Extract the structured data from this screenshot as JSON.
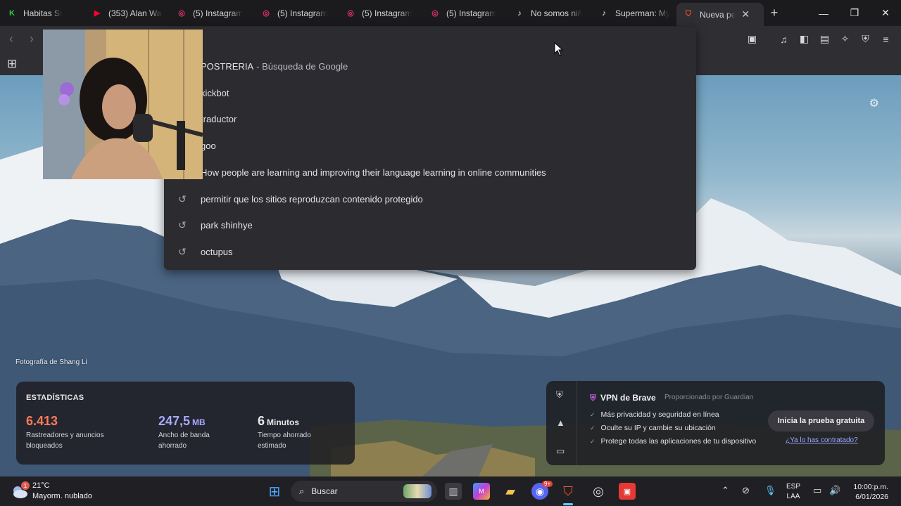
{
  "tabs": [
    {
      "title": "Habitas St",
      "icon": "habitas-icon",
      "color": "#2ecc40"
    },
    {
      "title": "(353) Alan Wal",
      "icon": "youtube-icon",
      "color": "#ff0033"
    },
    {
      "title": "(5) Instagram",
      "icon": "instagram-icon",
      "color": "#e1306c"
    },
    {
      "title": "(5) Instagram",
      "icon": "instagram-icon",
      "color": "#e1306c"
    },
    {
      "title": "(5) Instagram",
      "icon": "instagram-icon",
      "color": "#e1306c"
    },
    {
      "title": "(5) Instagram",
      "icon": "instagram-icon",
      "color": "#e1306c"
    },
    {
      "title": "No somos niñ",
      "icon": "tiktok-icon",
      "color": "#ffffff"
    },
    {
      "title": "Superman: My",
      "icon": "tiktok-icon",
      "color": "#ffffff"
    },
    {
      "title": "Nueva pe",
      "icon": "brave-icon",
      "color": "#fb542b",
      "active": true
    }
  ],
  "new_tab": "+",
  "window_controls": {
    "minimize": "—",
    "maximize": "❐",
    "close": "✕"
  },
  "suggestions": [
    {
      "text": "POSTRERIA",
      "sub": "- Búsqueda de Google",
      "history": false
    },
    {
      "text": "kickbot",
      "history": false
    },
    {
      "text": "traductor",
      "history": false
    },
    {
      "text": "goo",
      "history": false
    },
    {
      "text": "How people are learning and improving their language learning in online communities",
      "history": false
    },
    {
      "text": "permitir que los sitios reproduzcan contenido protegido",
      "history": true
    },
    {
      "text": "park shinhye",
      "history": true
    },
    {
      "text": "octupus",
      "history": true
    }
  ],
  "photo_credit": "Fotografía de Shang Li",
  "stats": {
    "title": "ESTADÍSTICAS",
    "blocked": {
      "value": "6.413",
      "label": "Rastreadores y anuncios bloqueados",
      "color": "#ff7a59"
    },
    "bandwidth": {
      "value": "247,5",
      "unit": "MB",
      "label": "Ancho de banda ahorrado",
      "color": "#a7a8ff"
    },
    "time": {
      "value": "6",
      "unit": "Minutos",
      "label": "Tiempo ahorrado estimado",
      "color": "#ffffff"
    }
  },
  "vpn": {
    "title": "VPN de Brave",
    "provider": "Proporcionado por  Guardian",
    "features": [
      "Más privacidad y seguridad en línea",
      "Oculte su IP y cambie su ubicación",
      "Protege todas las aplicaciones de tu dispositivo"
    ],
    "cta": "Inicia la prueba gratuita",
    "link": "¿Ya lo has contratado?"
  },
  "taskbar": {
    "weather_temp": "21°C",
    "weather_desc": "Mayorm. nublado",
    "weather_badge": "1",
    "search_placeholder": "Buscar",
    "lang_top": "ESP",
    "lang_bottom": "LAA",
    "time": "10:00:p.m.",
    "date": "6/01/2026",
    "chat_badge": "9+"
  }
}
